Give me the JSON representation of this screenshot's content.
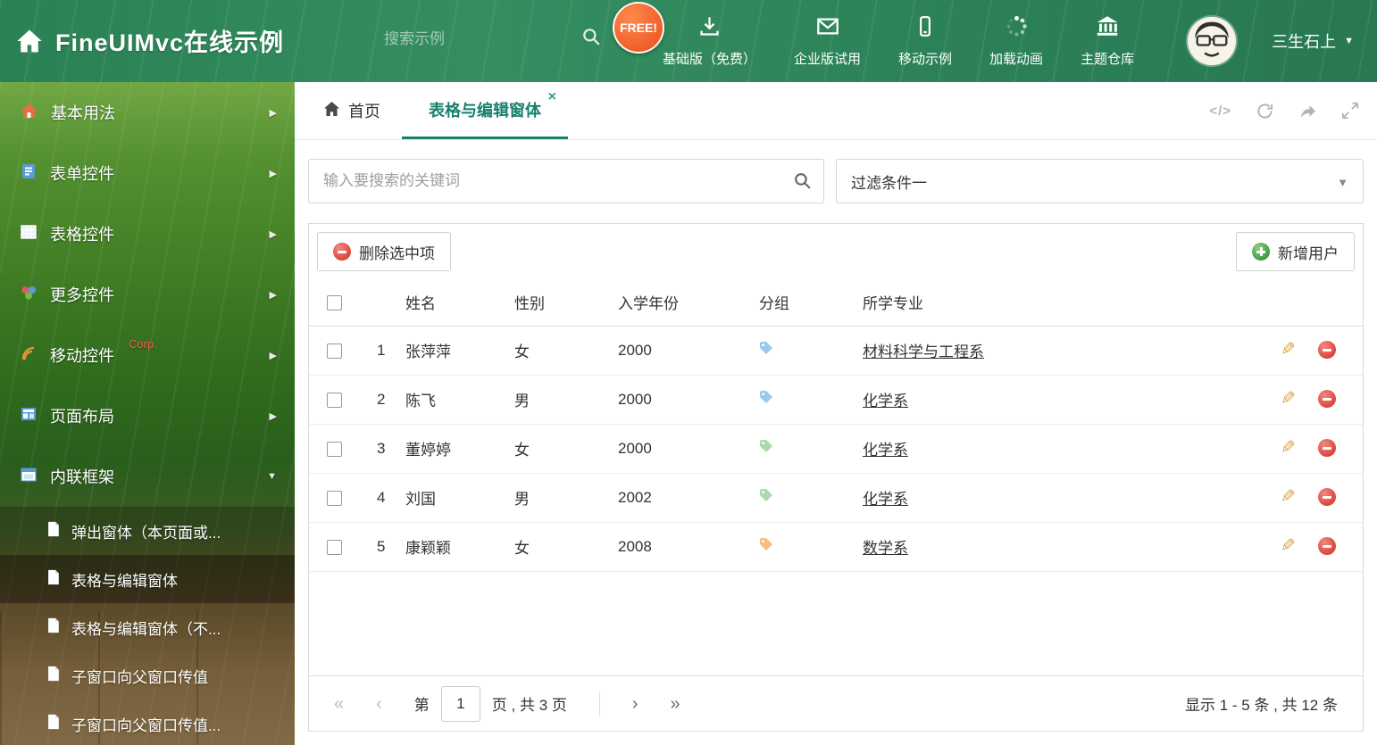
{
  "colors": {
    "accent_teal": "#17806f",
    "header_green": "#2e8b5f",
    "delete_red": "#da453a",
    "add_green": "#3f9b43",
    "tag_blue": "#85c1e9",
    "tag_green": "#9cd49c",
    "tag_orange": "#f5b26b"
  },
  "header": {
    "title": "FineUIMvc在线示例",
    "search_placeholder": "搜索示例",
    "free_badge": "FREE!",
    "nav": [
      {
        "label": "基础版（免费）",
        "icon": "download-icon"
      },
      {
        "label": "企业版试用",
        "icon": "mail-icon"
      },
      {
        "label": "移动示例",
        "icon": "mobile-icon"
      },
      {
        "label": "加载动画",
        "icon": "spinner-icon"
      },
      {
        "label": "主题仓库",
        "icon": "bank-icon"
      }
    ],
    "user": {
      "name": "三生石上",
      "caret": "▼"
    }
  },
  "sidebar": {
    "items": [
      {
        "label": "基本用法",
        "arrow": "▶"
      },
      {
        "label": "表单控件",
        "arrow": "▶"
      },
      {
        "label": "表格控件",
        "arrow": "▶"
      },
      {
        "label": "更多控件",
        "arrow": "▶"
      },
      {
        "label": "移动控件",
        "badge": "Corp.",
        "arrow": "▶"
      },
      {
        "label": "页面布局",
        "arrow": "▶"
      },
      {
        "label": "内联框架",
        "arrow": "▼"
      }
    ],
    "subitems": [
      {
        "label": "弹出窗体（本页面或..."
      },
      {
        "label": "表格与编辑窗体"
      },
      {
        "label": "表格与编辑窗体（不..."
      },
      {
        "label": "子窗口向父窗口传值"
      },
      {
        "label": "子窗口向父窗口传值..."
      }
    ]
  },
  "tabs": {
    "home": "首页",
    "active": "表格与编辑窗体",
    "close": "×",
    "code_glyph": "</>"
  },
  "filter": {
    "search_placeholder": "输入要搜索的关键词",
    "selected_filter": "过滤条件一",
    "caret": "▼"
  },
  "toolbar": {
    "delete_label": "删除选中项",
    "add_label": "新增用户"
  },
  "table": {
    "columns": {
      "name": "姓名",
      "gender": "性别",
      "year": "入学年份",
      "group": "分组",
      "major": "所学专业"
    },
    "rows": [
      {
        "num": "1",
        "name": "张萍萍",
        "gender": "女",
        "year": "2000",
        "tag_color": "#85c1e9",
        "major": "材料科学与工程系"
      },
      {
        "num": "2",
        "name": "陈飞",
        "gender": "男",
        "year": "2000",
        "tag_color": "#85c1e9",
        "major": "化学系"
      },
      {
        "num": "3",
        "name": "董婷婷",
        "gender": "女",
        "year": "2000",
        "tag_color": "#9cd49c",
        "major": "化学系"
      },
      {
        "num": "4",
        "name": "刘国",
        "gender": "男",
        "year": "2002",
        "tag_color": "#9cd49c",
        "major": "化学系"
      },
      {
        "num": "5",
        "name": "康颖颖",
        "gender": "女",
        "year": "2008",
        "tag_color": "#f5b26b",
        "major": "数学系"
      }
    ]
  },
  "pagination": {
    "first": "«",
    "prev": "‹",
    "next": "›",
    "last": "»",
    "page_prefix": "第",
    "page_value": "1",
    "page_suffix": "页 , 共 3 页",
    "summary": "显示 1 - 5 条 , 共 12 条"
  }
}
